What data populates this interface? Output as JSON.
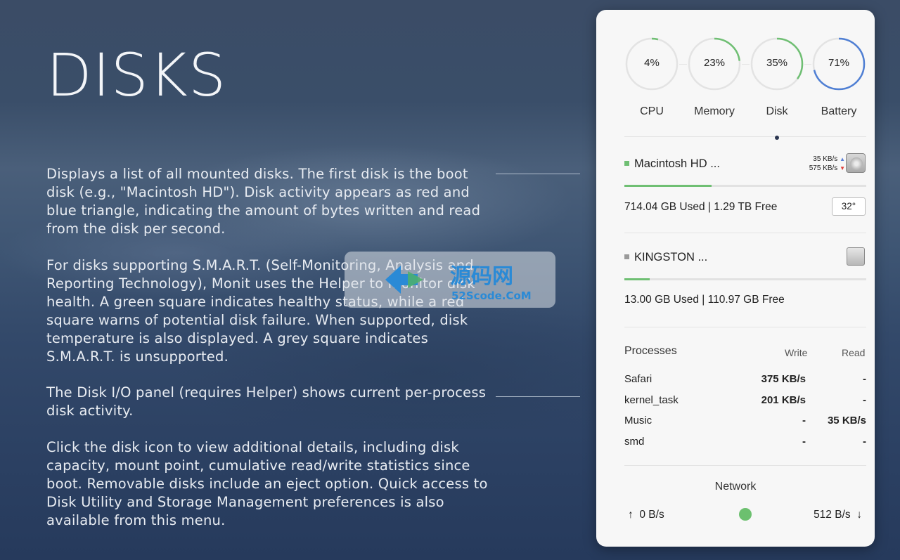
{
  "page": {
    "title": "DISKS",
    "paragraphs": [
      "Displays a list of all mounted disks. The first disk is the boot disk (e.g., \"Macintosh HD\").  Disk activity appears as red and blue triangle, indicating the amount of bytes written and read from the disk per second.",
      "For disks supporting S.M.A.R.T. (Self-Monitoring, Analysis and Reporting Technology), Monit uses the Helper to monitor disk health. A green square indicates healthy status, while a red square warns of potential disk failure. When supported, disk temperature is also displayed. A grey square indicates S.M.A.R.T. is unsupported.",
      "The Disk I/O panel (requires Helper) shows current per-process disk activity.",
      "Click the disk icon to view additional details, including disk capacity, mount point, cumulative read/write statistics since boot. Removable disks include an eject option. Quick access to Disk Utility and Storage Management preferences is also available from this menu."
    ],
    "watermark": {
      "line1": "源码网",
      "line2": "52Scode.CoM"
    }
  },
  "colors": {
    "accent_green": "#6fbf73",
    "battery_blue": "#4f7fd4",
    "write_red": "#e0403a",
    "read_blue": "#5b7fd6",
    "smart_grey": "#9a9a9a"
  },
  "gauges": [
    {
      "label": "CPU",
      "value_text": "4%",
      "value": 0.04,
      "color": "#6fbf73"
    },
    {
      "label": "Memory",
      "value_text": "23%",
      "value": 0.23,
      "color": "#6fbf73"
    },
    {
      "label": "Disk",
      "value_text": "35%",
      "value": 0.35,
      "color": "#6fbf73"
    },
    {
      "label": "Battery",
      "value_text": "71%",
      "value": 0.71,
      "color": "#4f7fd4"
    }
  ],
  "disks": [
    {
      "name": "Macintosh HD ...",
      "status": "healthy",
      "read_rate": "35 KB/s",
      "write_rate": "575 KB/s",
      "used_fraction": 0.36,
      "usage_text": "714.04 GB Used  |  1.29 TB Free",
      "temperature": "32°",
      "icon": "hard-drive-icon"
    },
    {
      "name": "KINGSTON ...",
      "status": "unsupported",
      "used_fraction": 0.105,
      "usage_text": "13.00 GB Used  |  110.97 GB Free",
      "icon": "ssd-drive-icon"
    }
  ],
  "processes": {
    "title": "Processes",
    "write_label": "Write",
    "read_label": "Read",
    "rows": [
      {
        "name": "Safari",
        "write": "375 KB/s",
        "read": "-"
      },
      {
        "name": "kernel_task",
        "write": "201 KB/s",
        "read": "-"
      },
      {
        "name": "Music",
        "write": "-",
        "read": "35 KB/s"
      },
      {
        "name": "smd",
        "write": "-",
        "read": "-"
      }
    ]
  },
  "network": {
    "title": "Network",
    "upload": "0 B/s",
    "download": "512 B/s",
    "up_arrow": "↑",
    "down_arrow": "↓"
  }
}
